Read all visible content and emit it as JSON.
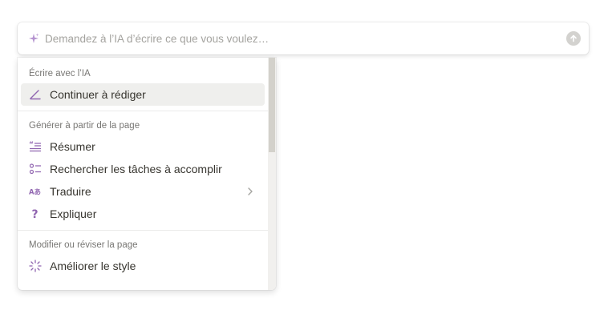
{
  "ai_bar": {
    "placeholder": "Demandez à l’IA d’écrire ce que vous voulez…",
    "spark_icon": "sparkle-icon",
    "submit_icon": "arrow-up-circle-icon"
  },
  "menu": {
    "sections": [
      {
        "title": "Écrire avec l’IA",
        "items": [
          {
            "label": "Continuer à rédiger",
            "icon": "pen-icon",
            "active": true
          }
        ]
      },
      {
        "title": "Générer à partir de la page",
        "items": [
          {
            "label": "Résumer",
            "icon": "quote-list-icon"
          },
          {
            "label": "Rechercher les tâches à accomplir",
            "icon": "checklist-icon"
          },
          {
            "label": "Traduire",
            "icon": "translate-icon",
            "has_submenu": true
          },
          {
            "label": "Expliquer",
            "icon": "question-icon"
          }
        ]
      },
      {
        "title": "Modifier ou réviser la page",
        "items": [
          {
            "label": "Améliorer le style",
            "icon": "magic-sparkle-icon"
          }
        ]
      }
    ]
  },
  "colors": {
    "accent_purple": "#9065b0",
    "text": "#37352f",
    "muted": "#787774",
    "hover_bg": "#efefed"
  }
}
